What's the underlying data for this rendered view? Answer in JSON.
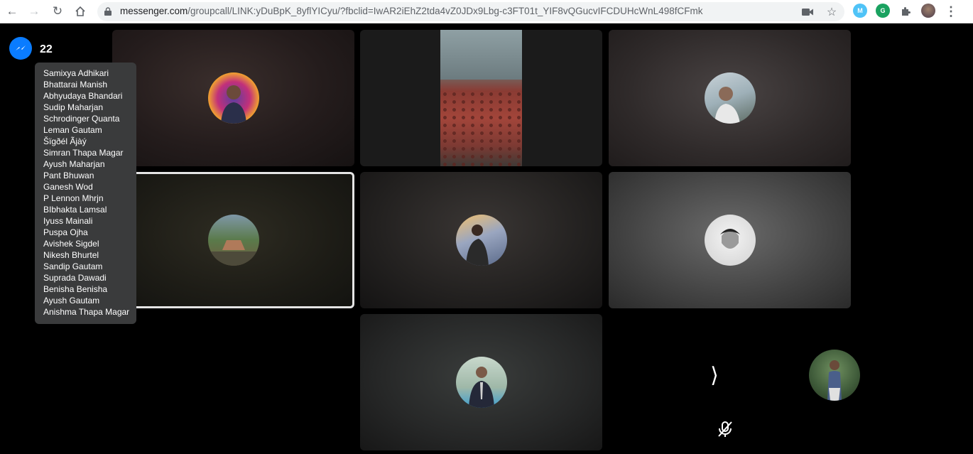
{
  "browser": {
    "url_host": "messenger.com",
    "url_path": "/groupcall/LINK:yDuBpK_8yflYICyu/?fbclid=IwAR2iEhZ2tda4vZ0JDx9Lbg-c3FT01t_YIF8vQGucvIFCDUHcWnL498fCFmk",
    "extensions": [
      {
        "name": "M",
        "color": "#4fc3f7"
      },
      {
        "name": "G",
        "color": "#1aa260"
      }
    ]
  },
  "call": {
    "participant_count": "22",
    "participants": [
      "Samixya Adhikari",
      "Bhattarai Manish",
      "Abhyudaya Bhandari",
      "Sudip Maharjan",
      "Schrodinger Quanta",
      "Leman Gautam",
      "Šïgðél Ãjàý",
      "Simran Thapa Magar",
      "Ayush Maharjan",
      "Pant Bhuwan",
      "Ganesh Wod",
      "P Lennon Mhrjn",
      "BIbhakta Lamsal",
      "Iyuss Mainali",
      "Puspa Ojha",
      "Avishek Sigdel",
      "Nikesh Bhurtel",
      "Sandip Gautam",
      "Suprada Dawadi",
      "Benisha Benisha",
      "Ayush Gautam",
      "Anishma Thapa Magar"
    ],
    "next_page_glyph": "⟩"
  },
  "colors": {
    "messenger_blue": "#0a7cff",
    "tooltip_bg": "#3a3b3c",
    "active_speaker_border": "#e4e4e4"
  }
}
